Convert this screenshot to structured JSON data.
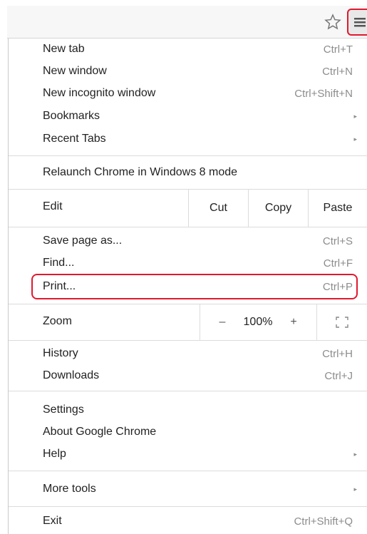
{
  "toolbar": {
    "star_icon": "star-outline-icon",
    "menu_icon": "hamburger-menu-icon",
    "highlight_color": "#e0192f"
  },
  "menu": {
    "group1": [
      {
        "label": "New tab",
        "shortcut": "Ctrl+T"
      },
      {
        "label": "New window",
        "shortcut": "Ctrl+N"
      },
      {
        "label": "New incognito window",
        "shortcut": "Ctrl+Shift+N"
      },
      {
        "label": "Bookmarks",
        "arrow": "▸"
      },
      {
        "label": "Recent Tabs",
        "arrow": "▸"
      }
    ],
    "relaunch": "Relaunch Chrome in Windows 8 mode",
    "edit_row": {
      "label": "Edit",
      "cut": "Cut",
      "copy": "Copy",
      "paste": "Paste"
    },
    "group2": [
      {
        "label": "Save page as...",
        "shortcut": "Ctrl+S"
      },
      {
        "label": "Find...",
        "shortcut": "Ctrl+F"
      },
      {
        "label": "Print...",
        "shortcut": "Ctrl+P"
      }
    ],
    "zoom_row": {
      "label": "Zoom",
      "minus": "–",
      "value": "100%",
      "plus": "+",
      "fullscreen_icon": "fullscreen-icon"
    },
    "group3": [
      {
        "label": "History",
        "shortcut": "Ctrl+H"
      },
      {
        "label": "Downloads",
        "shortcut": "Ctrl+J"
      }
    ],
    "group4": [
      {
        "label": "Settings"
      },
      {
        "label": "About Google Chrome"
      },
      {
        "label": "Help",
        "arrow": "▸"
      }
    ],
    "more_tools": {
      "label": "More tools",
      "arrow": "▸"
    },
    "exit": {
      "label": "Exit",
      "shortcut": "Ctrl+Shift+Q"
    }
  }
}
